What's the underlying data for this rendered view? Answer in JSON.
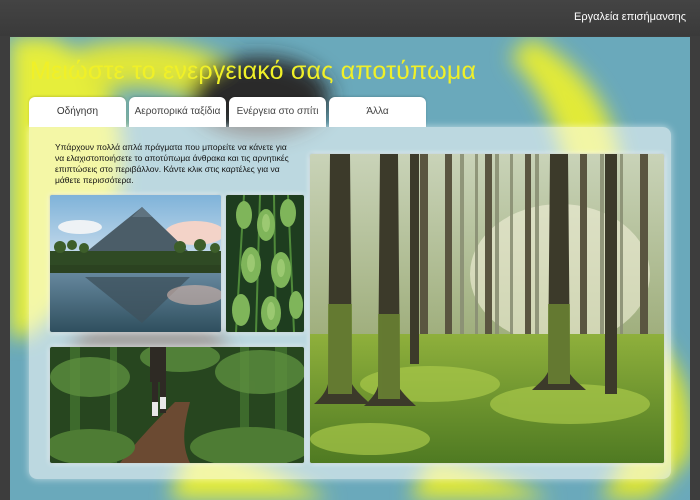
{
  "header": {
    "tools_link": "Εργαλεία επισήμανσης"
  },
  "page": {
    "title": "Μειώστε το ενεργειακό σας αποτύπωμα"
  },
  "tabs": [
    {
      "label": "Οδήγηση"
    },
    {
      "label": "Αεροπορικά ταξίδια"
    },
    {
      "label": "Ενέργεια στο σπίτι"
    },
    {
      "label": "Άλλα"
    }
  ],
  "content": {
    "intro": "Υπάρχουν πολλά απλά πράγματα που μπορείτε να κάνετε για να ελαχιστοποιήσετε το αποτύπωμα άνθρακα και τις αρνητικές επιπτώσεις στο περιβάλλον. Κάντε κλικ στις καρτέλες για να μάθετε περισσότερα."
  },
  "colors": {
    "topbar": "#3d3d3d",
    "title": "#f0f028",
    "background": "#5fa3b8",
    "accent_yellow": "#e4ec3a"
  }
}
